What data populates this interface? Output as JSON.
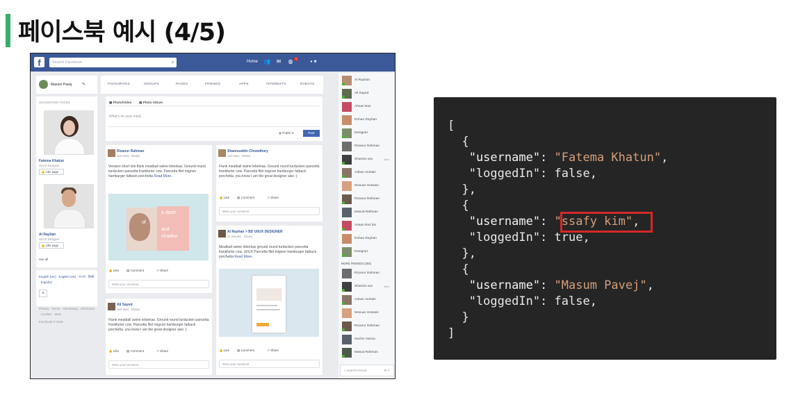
{
  "slide": {
    "title": "페이스북 예시 (4/5)"
  },
  "facebook": {
    "search_placeholder": "Search Facebook",
    "nav_home": "Home",
    "notification_count": "1",
    "user_name": "Masum Pavej",
    "tabs": [
      "FAVOURITES",
      "GROUPS",
      "PAGES",
      "FRIENDS",
      "APPS",
      "INTERESTS",
      "EVENTS"
    ],
    "suggested_heading": "SUGGESTED PAGES",
    "suggested": [
      {
        "name": "Fatema Khatun",
        "subtitle": "UI/UX Designer",
        "like": "Like page"
      },
      {
        "name": "Al Raylian",
        "subtitle": "UI/UX Designer",
        "like": "Like page"
      }
    ],
    "see_all": "See all",
    "languages": "English (UK) · English (US) · বাংলা · हिन्दी · Español",
    "footer_links": "Privacy · Terms · Advertising · AdChoices · Cookies · More",
    "copyright": "Facebook © 2016",
    "composer": {
      "photo_video": "Photo/Video",
      "photo_album": "Photo Album",
      "placeholder": "What's on your mind",
      "privacy": "Public",
      "post_button": "Post"
    },
    "posts": [
      {
        "author": "Rizanur Rahman",
        "meta": "Just Now · Dhaka",
        "body": "Venison short loin flank meatball swine leberkas. Ground round turducken pancetta frankfurter cow. Pancetta filet mignon hamburger fatback porchetta",
        "read_more": "Read More..",
        "image_text": [
          "a dash",
          "of",
          "and",
          "shadow"
        ]
      },
      {
        "author": "Ali Sayed",
        "meta": "Just Now · Dhaka",
        "body": "Flank meatball swine leberkas. Ground round turducken pancetta frankfurter cow. Pancetta filet mignon hamburger fatback porchetta. you know I am the great designer also :)"
      },
      {
        "author": "Shamsuddin Chowdhury",
        "meta": "Just Now · Dhaka",
        "body": "Flank meatball swine leberkas. Ground round turducken pancetta frankfurter cow. Pancetta filet mignon hamburger fatback porchetta. you know I am the great designer also :)"
      },
      {
        "author": "Al Rayhan > BD UI/UX DESIGNER",
        "meta": "11 minutes · Dhaka",
        "body": "Meatball swine leberkas ground round turducken pancetta frankfurter cow. UI/UX Pancetta filet mignon hamburger fatback porchetta",
        "read_more": "Read More.."
      }
    ],
    "actions": {
      "like": "Like",
      "comment": "Comment",
      "share": "Share",
      "write_comment": "Write your comment"
    },
    "chat": [
      "Al Rayhan",
      "Ali Sayed",
      "Ahsan Raz",
      "Rohan Rayhan",
      "Designer",
      "Rizanur Rahman",
      "Shamim ara",
      "Adnan mohain",
      "Monuar Hossain",
      "Rizanur Rahman",
      "Masud Rahman",
      "Ahsan Raz bin",
      "Rohan Rayhan",
      "Designer"
    ],
    "chat_time": "10m",
    "more_friends": "MORE FRIENDS (260)",
    "chat_more": [
      "Rizanur Rahman",
      "Shamim ara",
      "Adnan mohain",
      "Monuar Hossain",
      "Rizanur Rahman",
      "Sachin Varma",
      "Masud Rahman"
    ],
    "chat_search": "Search Friends"
  },
  "code": {
    "lines": [
      "[",
      "  {",
      "   \"username\": \"Fatema Khatun\",",
      "   \"loggedIn\": false,",
      "  },",
      "  {",
      "   \"username\": \"ssafy kim\",",
      "   \"loggedIn\": true,",
      "  },",
      "  {",
      "   \"username\": \"Masum Pavej\",",
      "   \"loggedIn\": false,",
      "  }",
      "]"
    ],
    "highlight_color": "#d62828"
  }
}
